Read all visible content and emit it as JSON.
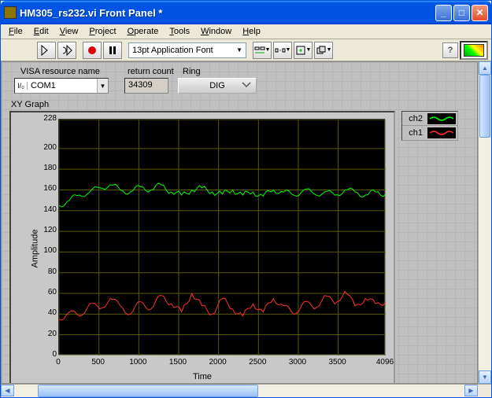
{
  "window": {
    "title": "HM305_rs232.vi Front Panel *"
  },
  "menu": {
    "file": "File",
    "edit": "Edit",
    "view": "View",
    "project": "Project",
    "operate": "Operate",
    "tools": "Tools",
    "window": "Window",
    "help": "Help"
  },
  "toolbar": {
    "font_text": "13pt Application Font",
    "help_char": "?"
  },
  "controls": {
    "visa_label": "VISA resource name",
    "visa_io": "I/₀",
    "visa_value": "COM1",
    "return_label": "return count",
    "return_value": "34309",
    "ring_label": "Ring",
    "ring_value": "DIG"
  },
  "graph": {
    "label": "XY Graph",
    "ylabel": "Amplitude",
    "xlabel": "Time",
    "legend": {
      "ch2": "ch2",
      "ch1": "ch1"
    }
  },
  "chart_data": {
    "type": "line",
    "title": "XY Graph",
    "xlabel": "Time",
    "ylabel": "Amplitude",
    "xlim": [
      0,
      4096
    ],
    "ylim": [
      0,
      228
    ],
    "xticks": [
      0,
      500,
      1000,
      1500,
      2000,
      2500,
      3000,
      3500,
      4096
    ],
    "yticks": [
      0,
      20,
      40,
      60,
      80,
      100,
      120,
      140,
      160,
      180,
      200,
      228
    ],
    "series": [
      {
        "name": "ch2",
        "color": "#00ff00",
        "x": [
          0,
          128,
          256,
          384,
          512,
          640,
          768,
          896,
          1024,
          1152,
          1280,
          1408,
          1536,
          1664,
          1792,
          1920,
          2048,
          2176,
          2304,
          2432,
          2560,
          2688,
          2816,
          2944,
          3072,
          3200,
          3328,
          3456,
          3584,
          3712,
          3840,
          3968,
          4096
        ],
        "y": [
          145,
          150,
          155,
          158,
          162,
          165,
          160,
          158,
          163,
          160,
          165,
          158,
          155,
          160,
          162,
          158,
          156,
          160,
          155,
          158,
          154,
          160,
          158,
          155,
          160,
          156,
          158,
          155,
          160,
          158,
          155,
          158,
          156
        ]
      },
      {
        "name": "ch1",
        "color": "#ff3030",
        "x": [
          0,
          128,
          256,
          384,
          512,
          640,
          768,
          896,
          1024,
          1152,
          1280,
          1408,
          1536,
          1664,
          1792,
          1920,
          2048,
          2176,
          2304,
          2432,
          2560,
          2688,
          2816,
          2944,
          3072,
          3200,
          3328,
          3456,
          3584,
          3712,
          3840,
          3968,
          4096
        ],
        "y": [
          35,
          42,
          38,
          50,
          45,
          55,
          48,
          40,
          52,
          45,
          58,
          50,
          42,
          60,
          48,
          40,
          55,
          45,
          38,
          50,
          42,
          55,
          48,
          40,
          52,
          45,
          58,
          50,
          62,
          48,
          55,
          50,
          52
        ]
      }
    ]
  }
}
